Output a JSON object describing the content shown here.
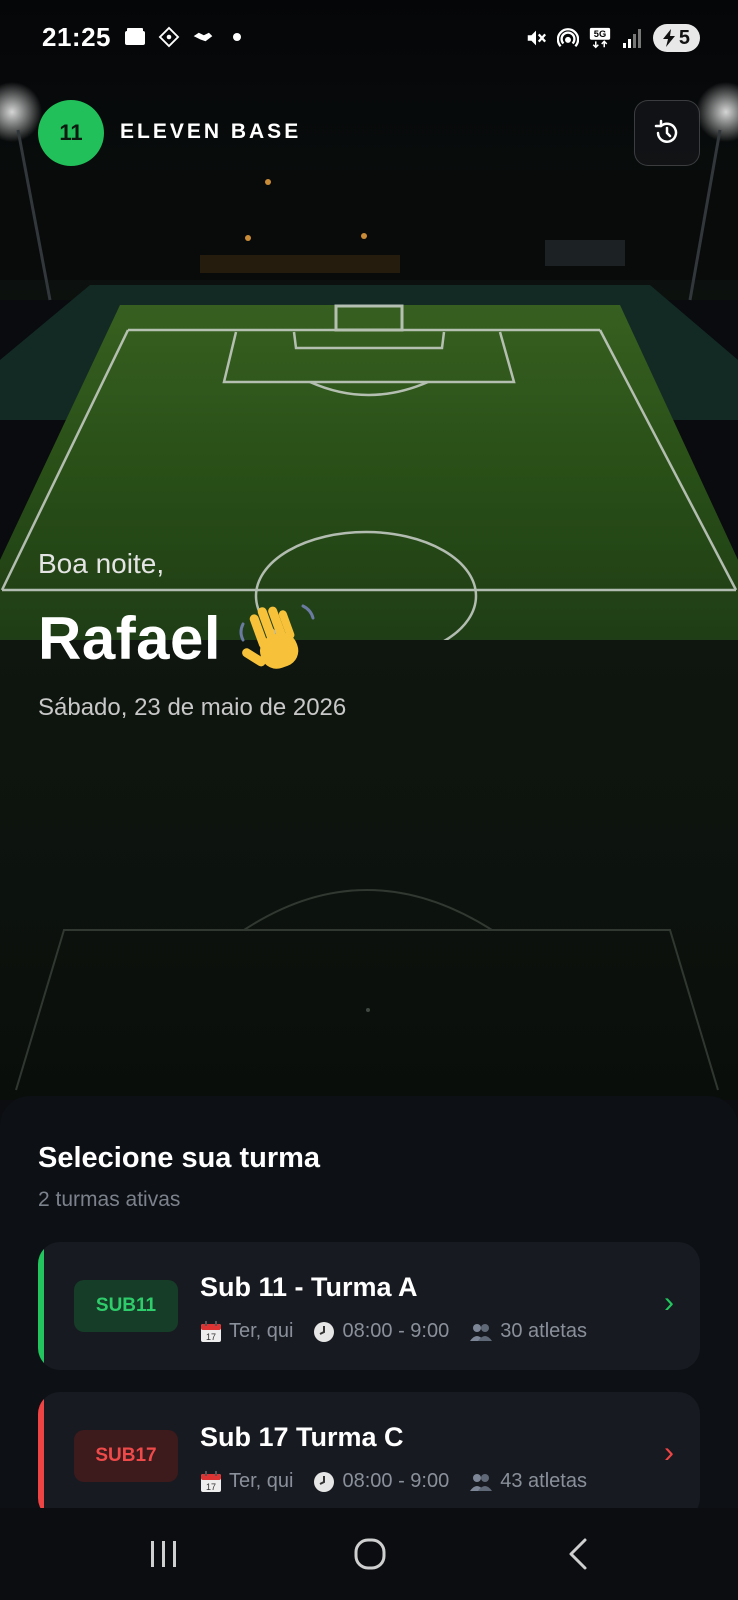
{
  "status_bar": {
    "time": "21:25",
    "battery_level": "5",
    "left_icons": [
      "wallet-icon",
      "grid-diamond-icon",
      "handshake-icon",
      "dot-icon"
    ],
    "right_icons": [
      "mute-icon",
      "hotspot-icon",
      "5g-icon",
      "signal-icon",
      "battery-icon"
    ]
  },
  "header": {
    "logo_text": "11",
    "brand": "ELEVEN BASE",
    "history_icon": "history-icon"
  },
  "greeting": {
    "label": "Boa noite,",
    "name": "Rafael",
    "emoji_icon": "waving-hand-icon",
    "date": "Sábado, 23 de maio de 2026"
  },
  "sheet": {
    "title": "Selecione sua turma",
    "subtitle": "2 turmas ativas",
    "classes": [
      {
        "badge": "SUB11",
        "title": "Sub 11 - Turma A",
        "days": "Ter, qui",
        "time": "08:00 - 9:00",
        "athletes": "30 atletas",
        "accent": "#22c55e"
      },
      {
        "badge": "SUB17",
        "title": "Sub 17 Turma C",
        "days": "Ter, qui",
        "time": "08:00 - 9:00",
        "athletes": "43 atletas",
        "accent": "#ef4444"
      }
    ]
  },
  "nav": {
    "icons": [
      "recent-apps-icon",
      "home-icon",
      "back-icon"
    ]
  },
  "colors": {
    "brand_green": "#21c05a",
    "sub11_accent": "#22c55e",
    "sub17_accent": "#ef4444",
    "background": "#0b0d10"
  }
}
